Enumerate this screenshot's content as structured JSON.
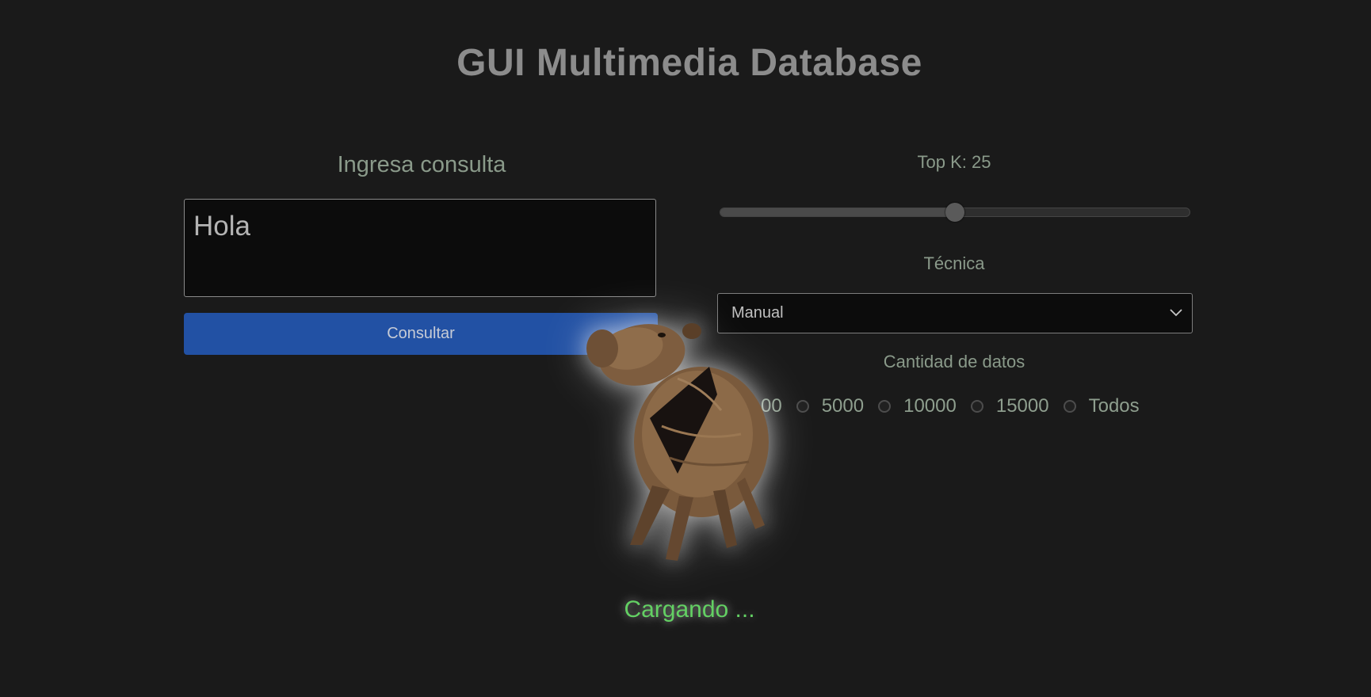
{
  "header": {
    "title": "GUI Multimedia Database"
  },
  "query": {
    "label": "Ingresa consulta",
    "value": "Hola",
    "button_label": "Consultar"
  },
  "topk": {
    "label": "Top K: 25",
    "value": 25,
    "fraction": 0.5
  },
  "tecnica": {
    "label": "Técnica",
    "selected": "Manual"
  },
  "cantidad": {
    "label": "Cantidad de datos",
    "options": [
      "00",
      "5000",
      "10000",
      "15000",
      "Todos"
    ]
  },
  "loading": {
    "text": "Cargando ...",
    "image": "capybara-image"
  },
  "colors": {
    "background": "#1a1a1a",
    "button": "#2251a4",
    "loading_text": "#63d063"
  }
}
